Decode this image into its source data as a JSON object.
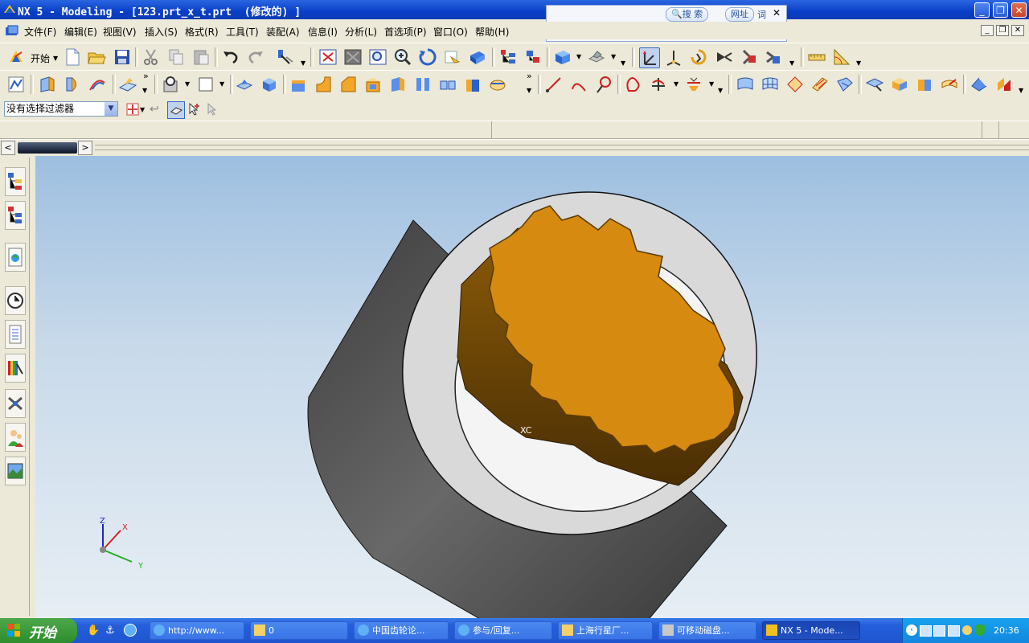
{
  "window": {
    "title": "NX 5 - Modeling - [123.prt_x_t.prt  (修改的) ]"
  },
  "search_popup": {
    "search_label": "搜 索",
    "url_label": "网址",
    "word_label": "词"
  },
  "menu": {
    "items": [
      {
        "label": "文件(F)"
      },
      {
        "label": "编辑(E)"
      },
      {
        "label": "视图(V)"
      },
      {
        "label": "插入(S)"
      },
      {
        "label": "格式(R)"
      },
      {
        "label": "工具(T)"
      },
      {
        "label": "装配(A)"
      },
      {
        "label": "信息(I)"
      },
      {
        "label": "分析(L)"
      },
      {
        "label": "首选项(P)"
      },
      {
        "label": "窗口(O)"
      },
      {
        "label": "帮助(H)"
      }
    ]
  },
  "toolbar": {
    "start_label": "开始"
  },
  "filter": {
    "selected": "没有选择过滤器"
  },
  "viewport": {
    "triad_labels": {
      "z": "Z",
      "x": "X",
      "y": "Y"
    },
    "csys_label": "XC",
    "colors": {
      "gear": "#d68a0f",
      "ring": "#d9d9d9",
      "cylinder": "#5a5a5a"
    }
  },
  "taskbar": {
    "start_label": "开始",
    "tasks": [
      {
        "label": "http://www..."
      },
      {
        "label": "0"
      },
      {
        "label": "中国齿轮论..."
      },
      {
        "label": "参与/回复..."
      },
      {
        "label": "上海行星厂..."
      },
      {
        "label": "可移动磁盘..."
      },
      {
        "label": "NX 5 - Mode..."
      }
    ],
    "clock": "20:36"
  }
}
